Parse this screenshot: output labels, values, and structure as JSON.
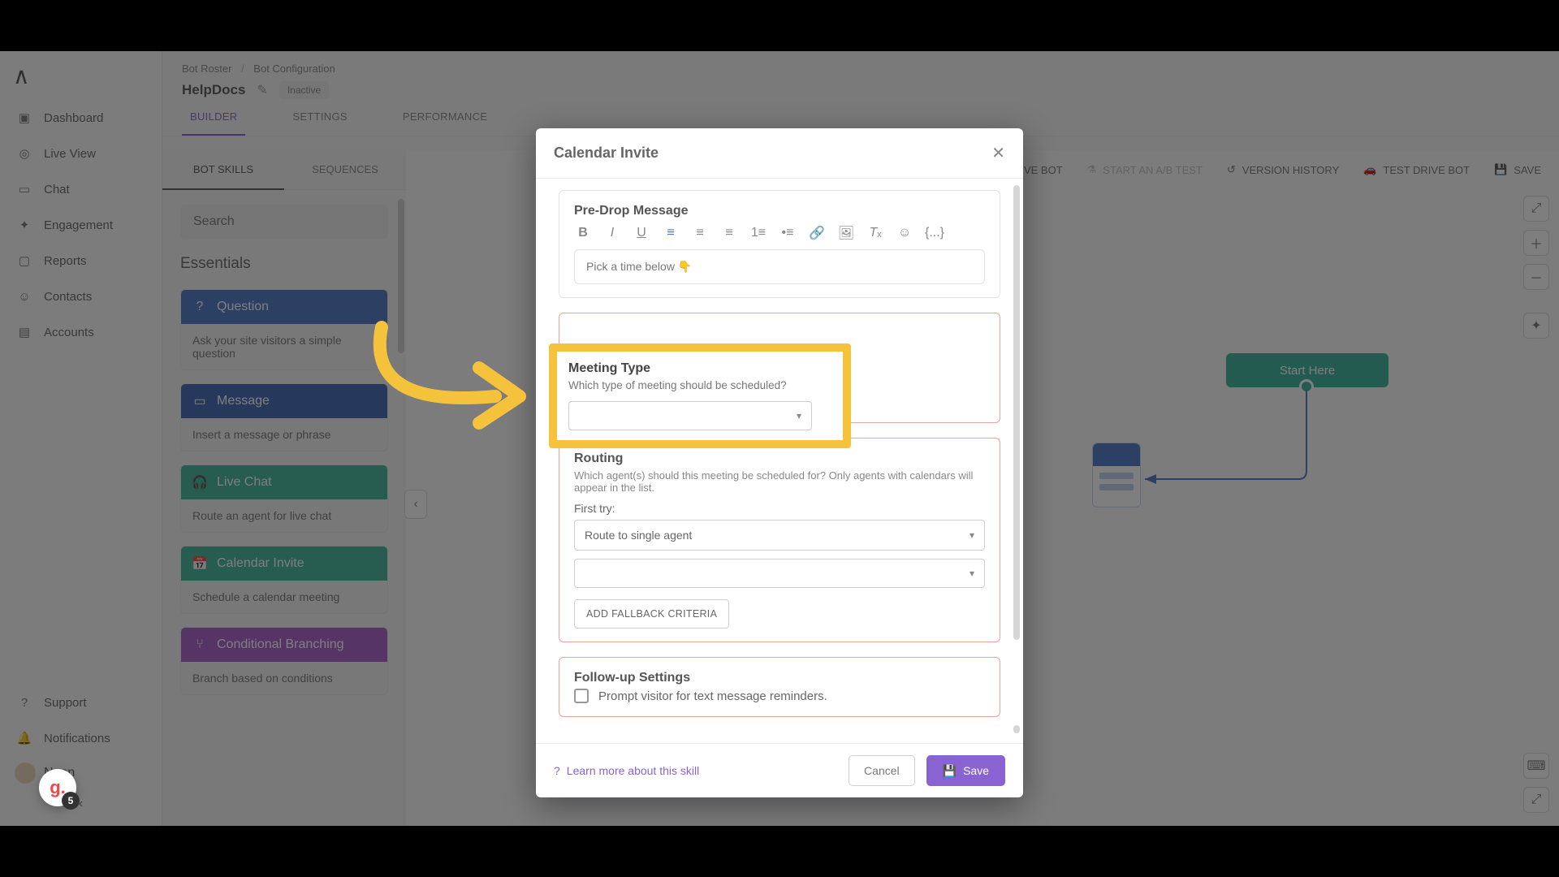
{
  "nav": {
    "items": [
      "Dashboard",
      "Live View",
      "Chat",
      "Engagement",
      "Reports",
      "Contacts",
      "Accounts"
    ],
    "support": "Support",
    "notifications": "Notifications",
    "user": "Ngan"
  },
  "breadcrumb": {
    "a": "Bot Roster",
    "b": "Bot Configuration"
  },
  "bot": {
    "name": "HelpDocs",
    "status": "Inactive"
  },
  "tabs": [
    "BUILDER",
    "SETTINGS",
    "PERFORMANCE"
  ],
  "subtabs": [
    "BOT SKILLS",
    "SEQUENCES"
  ],
  "search_placeholder": "Search",
  "section": "Essentials",
  "skills": [
    {
      "title": "Question",
      "desc": "Ask your site visitors a simple question"
    },
    {
      "title": "Message",
      "desc": "Insert a message or phrase"
    },
    {
      "title": "Live Chat",
      "desc": "Route an agent for live chat"
    },
    {
      "title": "Calendar Invite",
      "desc": "Schedule a calendar meeting"
    },
    {
      "title": "Conditional Branching",
      "desc": "Branch based on conditions"
    }
  ],
  "canvas": {
    "start": "Start Here",
    "actions": {
      "archive": "ARCHIVE BOT",
      "ab": "START AN A/B TEST",
      "history": "VERSION HISTORY",
      "test": "TEST DRIVE BOT",
      "save": "SAVE"
    }
  },
  "modal": {
    "title": "Calendar Invite",
    "predrop": {
      "title": "Pre-Drop Message",
      "text": "Pick a time below 👇"
    },
    "meeting": {
      "title": "Meeting Type",
      "sub": "Which type of meeting should be scheduled?",
      "value": ""
    },
    "routing": {
      "title": "Routing",
      "sub": "Which agent(s) should this meeting be scheduled for? Only agents with calendars will appear in the list.",
      "first": "First try:",
      "route": "Route to single agent",
      "fallback": "ADD FALLBACK CRITERIA"
    },
    "follow": {
      "title": "Follow-up Settings",
      "chk": "Prompt visitor for text message reminders."
    },
    "learn": "Learn more about this skill",
    "cancel": "Cancel",
    "save": "Save"
  },
  "gbadge": {
    "g": "g.",
    "n": "5"
  }
}
